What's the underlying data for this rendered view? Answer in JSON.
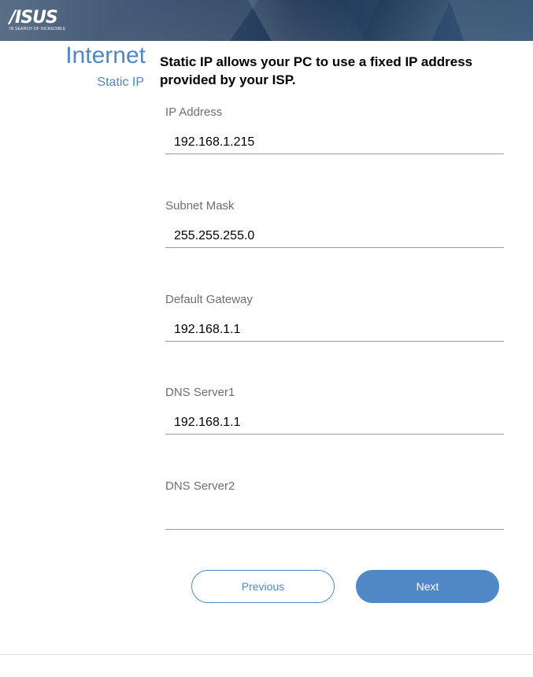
{
  "header": {
    "logo_text": "/ISUS",
    "logo_tagline": "IN SEARCH OF INCREDIBLE"
  },
  "section": {
    "title": "Internet",
    "subtitle": "Static IP",
    "description": "Static IP allows your PC to use a fixed IP address provided by your ISP."
  },
  "fields": [
    {
      "label": "IP Address",
      "value": "192.168.1.215"
    },
    {
      "label": "Subnet Mask",
      "value": "255.255.255.0"
    },
    {
      "label": "Default Gateway",
      "value": "192.168.1.1"
    },
    {
      "label": "DNS Server1",
      "value": "192.168.1.1"
    },
    {
      "label": "DNS Server2",
      "value": ""
    }
  ],
  "buttons": {
    "previous": "Previous",
    "next": "Next"
  },
  "colors": {
    "accent": "#4f87c7",
    "header_dark": "#1f3756"
  }
}
